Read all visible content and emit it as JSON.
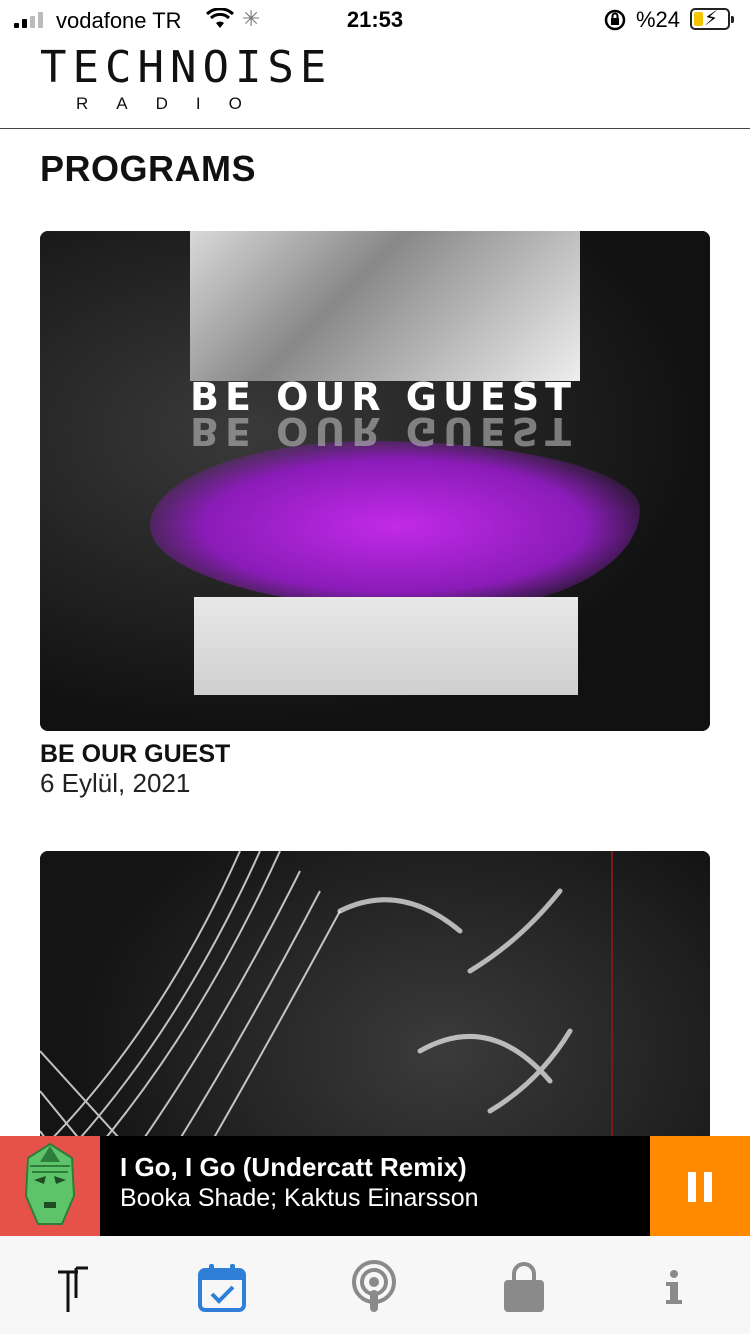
{
  "status_bar": {
    "carrier": "vodafone TR",
    "time": "21:53",
    "battery_percent": "%24",
    "icons": [
      "signal-icon",
      "wifi-icon",
      "activity-spinner-icon",
      "rotation-lock-icon",
      "battery-charging-icon"
    ]
  },
  "header": {
    "logo_main": "TECHNOISE",
    "logo_sub": "RADIO"
  },
  "page": {
    "title": "PROGRAMS"
  },
  "programs": [
    {
      "artwork_text": "BE OUR GUEST",
      "title": "BE OUR GUEST",
      "date": "6 Eylül, 2021"
    },
    {
      "artwork_text": "",
      "title": "",
      "date": ""
    }
  ],
  "now_playing": {
    "title": "I Go, I Go (Undercatt Remix)",
    "artist": "Booka Shade; Kaktus Einarsson",
    "state": "playing",
    "colors": {
      "art_bg": "#e6524a",
      "button_bg": "#ff8a00"
    }
  },
  "tabs": [
    {
      "name": "home",
      "icon": "technoise-logo-icon",
      "active": false
    },
    {
      "name": "schedule",
      "icon": "calendar-check-icon",
      "active": true
    },
    {
      "name": "podcast",
      "icon": "podcast-icon",
      "active": false
    },
    {
      "name": "shop",
      "icon": "shopping-bag-icon",
      "active": false
    },
    {
      "name": "info",
      "icon": "info-icon",
      "active": false
    }
  ],
  "colors": {
    "active_tab": "#2f7ed8",
    "inactive_tab": "#8a8a8a",
    "accent_purple": "#b126d9"
  }
}
